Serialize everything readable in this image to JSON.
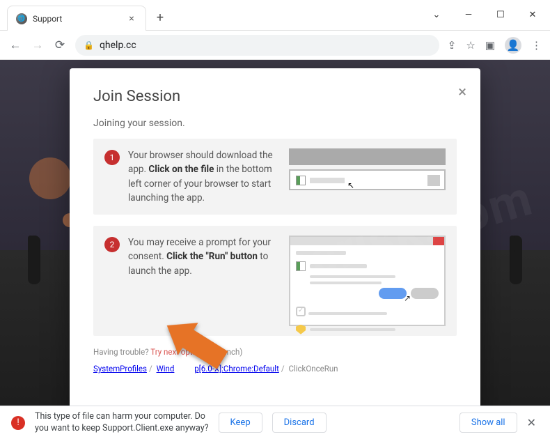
{
  "tab": {
    "title": "Support"
  },
  "address": {
    "url": "qhelp.cc"
  },
  "modal": {
    "title": "Join Session",
    "subtitle": "Joining your session.",
    "step1": {
      "num": "1",
      "text_a": "Your browser should download the app. ",
      "text_b": "Click on the file",
      "text_c": " in the bottom left corner of your browser to start launching the app."
    },
    "step2": {
      "num": "2",
      "text_a": "You may receive a prompt for your consent. ",
      "text_b": "Click the \"Run\" button",
      "text_c": " to launch the app."
    },
    "trouble": {
      "label": "Having trouble? ",
      "link": "Try next option",
      "suffix": "aunch)"
    },
    "crumbs": {
      "a": "SystemProfiles",
      "b": "Wind",
      "c": "p[6.0-X]:Chrome:Default",
      "d": "ClickOnceRun"
    }
  },
  "download": {
    "line1": "This type of file can harm your computer. Do",
    "line2_a": "you want to keep ",
    "filename": "Support.Client.exe",
    "line2_b": " anyway?",
    "keep": "Keep",
    "discard": "Discard",
    "showall": "Show all"
  }
}
